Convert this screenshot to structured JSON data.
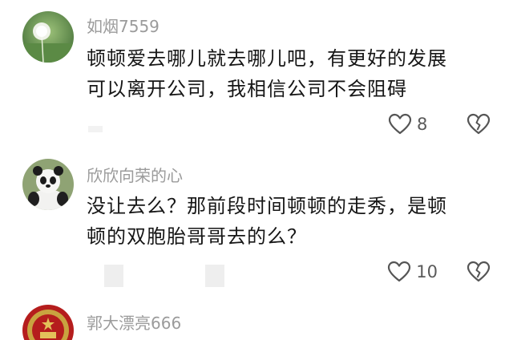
{
  "comments": [
    {
      "username": "如烟7559",
      "avatar_icon": "dandelion-avatar",
      "text_lines": [
        "顿顿爱去哪儿就去哪儿吧，有更好的发展",
        "可以离开公司，我相信公司不会阻碍"
      ],
      "like_icon": "heart-outline-icon",
      "likes": "8",
      "dislike_icon": "broken-heart-icon"
    },
    {
      "username": "欣欣向荣的心",
      "avatar_icon": "panda-avatar",
      "text_lines": [
        "没让去么？那前段时间顿顿的走秀，是顿",
        "顿的双胞胎哥哥去的么？"
      ],
      "like_icon": "heart-outline-icon",
      "likes": "10",
      "dislike_icon": "broken-heart-icon"
    },
    {
      "username": "郭大漂亮666",
      "avatar_icon": "emblem-avatar"
    }
  ],
  "colors": {
    "username": "#9b9b9b",
    "text": "#161616",
    "icon": "#555555"
  }
}
